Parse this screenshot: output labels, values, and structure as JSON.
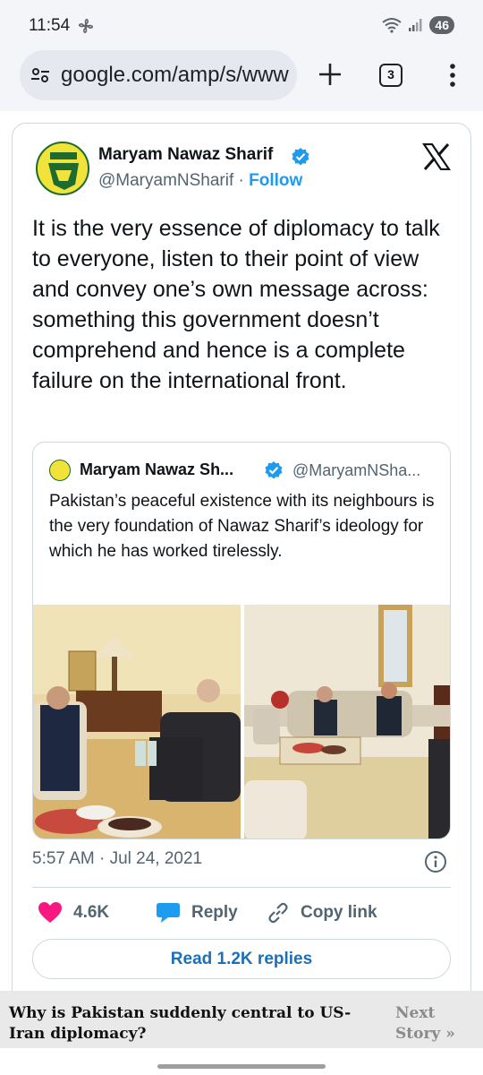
{
  "status_bar": {
    "time": "11:54",
    "battery": "46"
  },
  "browser": {
    "url": "google.com/amp/s/www",
    "tab_count": "3"
  },
  "tweet": {
    "author_name": "Maryam Nawaz Sharif",
    "handle": "@MaryamNSharif",
    "separator": " · ",
    "follow_label": "Follow",
    "text": "It is the very essence of diplomacy to talk to everyone, listen to their point of view and convey one’s own message across: something this government doesn’t comprehend and hence is a complete failure on the international front.",
    "timestamp": "5:57 AM · Jul 24, 2021",
    "likes": "4.6K",
    "reply_label": "Reply",
    "copy_link_label": "Copy link",
    "read_replies_label": "Read 1.2K replies",
    "quoted": {
      "author_name": "Maryam Nawaz Sh...",
      "handle": "@MaryamNSha...",
      "text": "Pakistan’s peaceful existence with its neighbours is the very foundation of Nawaz Sharif’s ideology for which he has worked tirelessly."
    }
  },
  "story_bar": {
    "title": "Why is Pakistan suddenly central to US-Iran diplomacy?",
    "next_label": "Next Story »"
  },
  "colors": {
    "accent_blue": "#1d9bf0",
    "like_pink": "#f91880",
    "text_secondary": "#536471"
  }
}
